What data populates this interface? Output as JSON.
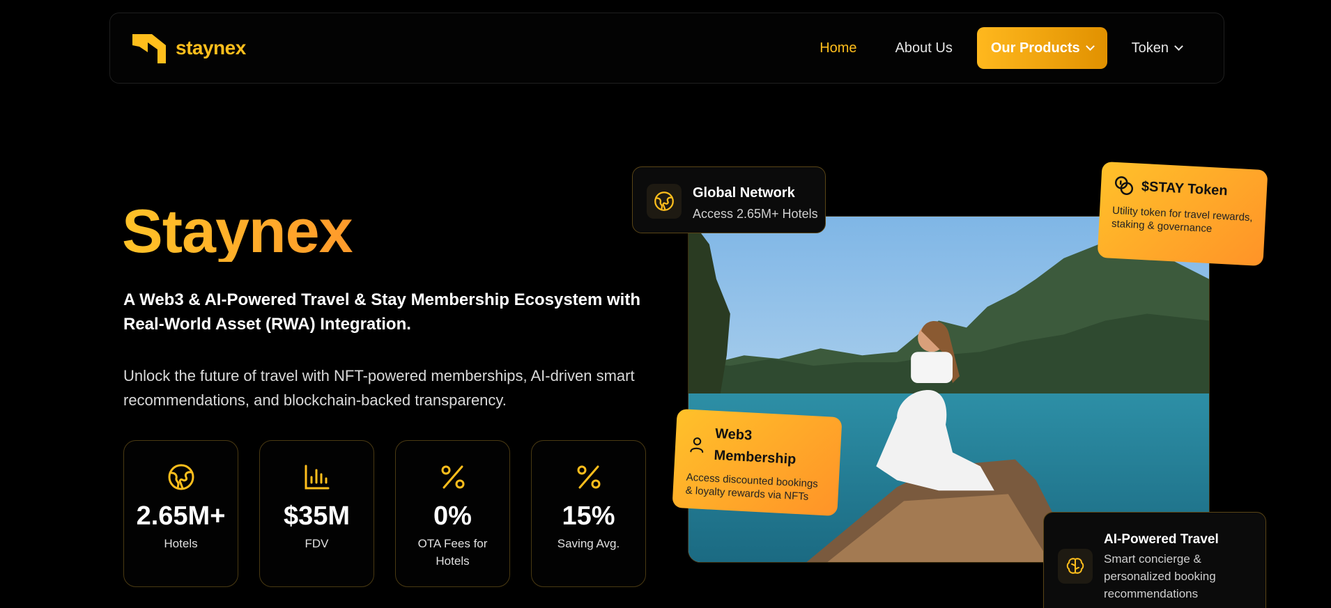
{
  "brand": {
    "name": "staynex",
    "accent": "#ffbe1c"
  },
  "nav": {
    "items": [
      {
        "label": "Home",
        "active": true
      },
      {
        "label": "About Us"
      },
      {
        "label": "Our Products",
        "highlight": true,
        "dropdown": true
      },
      {
        "label": "Token",
        "dropdown": true
      }
    ]
  },
  "hero": {
    "title": "Staynex",
    "subtitle": "A Web3 & AI-Powered Travel & Stay Membership Ecosystem with Real-World Asset (RWA) Integration.",
    "description": "Unlock the future of travel with NFT-powered memberships, AI-driven smart recommendations, and blockchain-backed transparency."
  },
  "stats": [
    {
      "icon": "globe-icon",
      "value": "2.65M+",
      "label": "Hotels"
    },
    {
      "icon": "bar-chart-icon",
      "value": "$35M",
      "label": "FDV"
    },
    {
      "icon": "percent-icon",
      "value": "0%",
      "label": "OTA Fees for Hotels"
    },
    {
      "icon": "percent-icon",
      "value": "15%",
      "label": "Saving Avg."
    }
  ],
  "cards": {
    "global": {
      "title": "Global Network",
      "text": "Access 2.65M+ Hotels",
      "icon": "globe-icon"
    },
    "token": {
      "title": "$STAY Token",
      "text": "Utility token for travel rewards, staking & governance",
      "icon": "coins-icon"
    },
    "web3": {
      "title": "Web3 Membership",
      "text": "Access discounted bookings & loyalty rewards via NFTs",
      "icon": "user-icon"
    },
    "ai": {
      "title": "AI-Powered Travel",
      "text": "Smart concierge & personalized booking recommendations",
      "icon": "brain-icon"
    }
  }
}
